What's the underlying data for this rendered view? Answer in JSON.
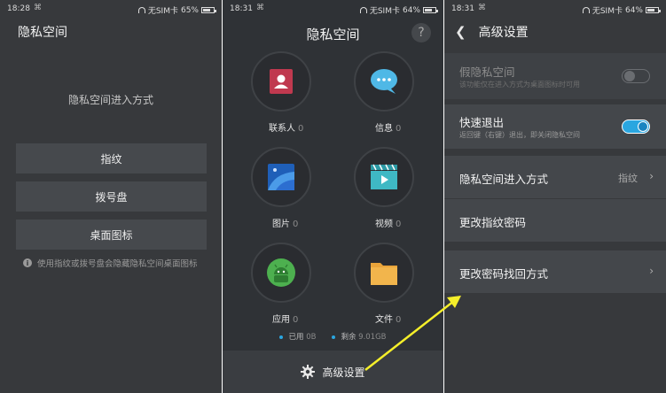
{
  "screen1": {
    "status": {
      "time": "18:28",
      "carrier": "无SIM卡",
      "battery": "65%"
    },
    "title": "隐私空间",
    "subtitle": "隐私空间进入方式",
    "options": [
      {
        "label": "指纹"
      },
      {
        "label": "拨号盘"
      },
      {
        "label": "桌面图标"
      }
    ],
    "note": "使用指纹或拨号盘会隐藏隐私空间桌面图标"
  },
  "screen2": {
    "status": {
      "time": "18:31",
      "carrier": "无SIM卡",
      "battery": "64%"
    },
    "title": "隐私空间",
    "help": "?",
    "apps": [
      {
        "label": "联系人",
        "count": "0",
        "icon": "contacts-icon"
      },
      {
        "label": "信息",
        "count": "0",
        "icon": "messages-icon"
      },
      {
        "label": "图片",
        "count": "0",
        "icon": "gallery-icon"
      },
      {
        "label": "视频",
        "count": "0",
        "icon": "video-icon"
      },
      {
        "label": "应用",
        "count": "0",
        "icon": "android-icon"
      },
      {
        "label": "文件",
        "count": "0",
        "icon": "folder-icon"
      }
    ],
    "storage": {
      "used_label": "已用",
      "used_value": "0B",
      "free_label": "剩余",
      "free_value": "9.01GB"
    },
    "advanced": "高级设置"
  },
  "screen3": {
    "status": {
      "time": "18:31",
      "carrier": "无SIM卡",
      "battery": "64%"
    },
    "title": "高级设置",
    "fake_space": {
      "label": "假隐私空间",
      "desc": "该功能仅在进入方式为桌面图标时可用",
      "enabled": false
    },
    "quick_exit": {
      "label": "快速退出",
      "desc": "返回键（右键）退出，即关闭隐私空间",
      "enabled": true
    },
    "entry_method": {
      "label": "隐私空间进入方式",
      "value": "指纹"
    },
    "change_password": {
      "label": "更改指纹密码"
    },
    "recovery": {
      "label": "更改密码找回方式"
    }
  },
  "colors": {
    "accent": "#2aa6e0",
    "arrow": "#f5ef2a"
  }
}
